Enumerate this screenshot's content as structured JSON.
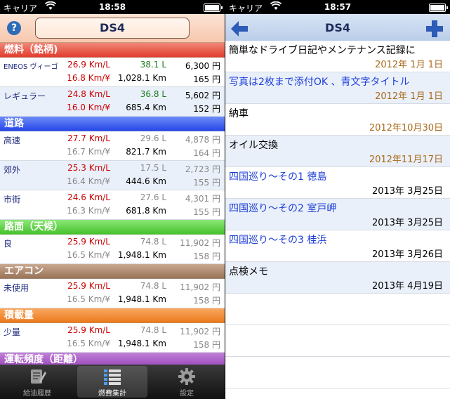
{
  "left": {
    "status": {
      "carrier": "キャリア",
      "time": "18:58"
    },
    "title": "DS4",
    "sections": [
      {
        "name": "燃料（銘柄)",
        "color": "#e23c2e",
        "rows": [
          {
            "label": "ENEOS ヴィーゴ",
            "v": [
              "26.9 Km/L",
              "38.1 L",
              "6,300 円",
              "16.8 Km/¥",
              "1,028.1 Km",
              "165 円"
            ]
          },
          {
            "label": "レギュラー",
            "v": [
              "24.8 Km/L",
              "36.8 L",
              "5,602 円",
              "16.0 Km/¥",
              "685.4 Km",
              "152 円"
            ]
          }
        ]
      },
      {
        "name": "道路",
        "color": "#2746e8",
        "rows": [
          {
            "label": "高速",
            "v": [
              "27.7 Km/L",
              "29.6 L",
              "4,878 円",
              "16.7 Km/¥",
              "821.7 Km",
              "164 円"
            ]
          },
          {
            "label": "郊外",
            "v": [
              "25.3 Km/L",
              "17.5 L",
              "2,723 円",
              "16.4 Km/¥",
              "444.6 Km",
              "155 円"
            ]
          },
          {
            "label": "市街",
            "v": [
              "24.6 Km/L",
              "27.6 L",
              "4,301 円",
              "16.3 Km/¥",
              "681.8 Km",
              "155 円"
            ]
          }
        ]
      },
      {
        "name": "路面（天候）",
        "color": "#46c22c",
        "rows": [
          {
            "label": "良",
            "v": [
              "25.9 Km/L",
              "74.8 L",
              "11,902 円",
              "16.5 Km/¥",
              "1,948.1 Km",
              "158 円"
            ]
          }
        ]
      },
      {
        "name": "エアコン",
        "color": "#9a7458",
        "rows": [
          {
            "label": "未使用",
            "v": [
              "25.9 Km/L",
              "74.8 L",
              "11,902 円",
              "16.5 Km/¥",
              "1,948.1 Km",
              "158 円"
            ]
          }
        ]
      },
      {
        "name": "積載量",
        "color": "#ec7a1c",
        "rows": [
          {
            "label": "少量",
            "v": [
              "25.9 Km/L",
              "74.8 L",
              "11,902 円",
              "16.5 Km/¥",
              "1,948.1 Km",
              "158 円"
            ]
          }
        ]
      },
      {
        "name": "運転頻度（距離）",
        "color": "#9a48b8",
        "rows": []
      }
    ],
    "tabs": [
      {
        "label": "給油履歴",
        "icon": "notepad-icon"
      },
      {
        "label": "燃費集計",
        "icon": "list-icon"
      },
      {
        "label": "設定",
        "icon": "gear-icon"
      }
    ]
  },
  "right": {
    "status": {
      "carrier": "キャリア",
      "time": "18:57"
    },
    "title": "DS4",
    "items": [
      {
        "title": "簡単なドライブ日記やメンテナンス記録に",
        "date": "2012年 1月 1日",
        "title_color": "black",
        "date_color": "brown"
      },
      {
        "title": "写真は2枚まで添付OK 、青文字タイトル",
        "date": "2012年 1月 1日",
        "title_color": "blue",
        "date_color": "brown"
      },
      {
        "title": "納車",
        "date": "2012年10月30日",
        "title_color": "black",
        "date_color": "brown"
      },
      {
        "title": "オイル交換",
        "date": "2012年11月17日",
        "title_color": "black",
        "date_color": "brown"
      },
      {
        "title": "四国巡り～その1 徳島",
        "date": "2013年 3月25日",
        "title_color": "blue",
        "date_color": "black"
      },
      {
        "title": "四国巡り～その2 室戸岬",
        "date": "2013年 3月25日",
        "title_color": "blue",
        "date_color": "black"
      },
      {
        "title": "四国巡り～その3 桂浜",
        "date": "2013年 3月26日",
        "title_color": "blue",
        "date_color": "black"
      },
      {
        "title": "点検メモ",
        "date": "2013年 4月19日",
        "title_color": "black",
        "date_color": "black"
      }
    ]
  }
}
